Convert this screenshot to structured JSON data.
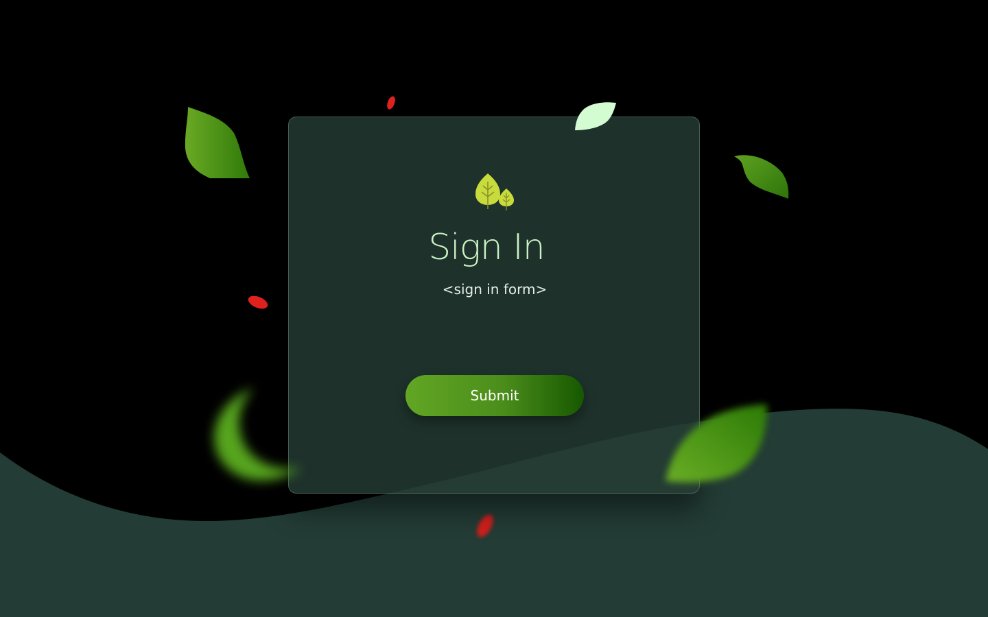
{
  "page": {
    "background_color": "#000000",
    "wave_color": "#233c35"
  },
  "form": {
    "logo_icon": "leaves-icon",
    "title": "Sign In",
    "placeholder_text": "<sign in form>",
    "submit_label": "Submit"
  },
  "theme": {
    "card_color": "#1d332c",
    "title_color": "#c9f3c4",
    "button_gradient": [
      "#62a624",
      "#165800"
    ],
    "leaf_green": "#4b8d1b",
    "leaf_pale": "#d4fcd3",
    "petal_red": "#e0221f"
  },
  "decorations": [
    "leaf-icon",
    "pale-leaf-icon",
    "crescent-leaf-icon",
    "blurred-leaf-icon",
    "red-petal-icon"
  ]
}
